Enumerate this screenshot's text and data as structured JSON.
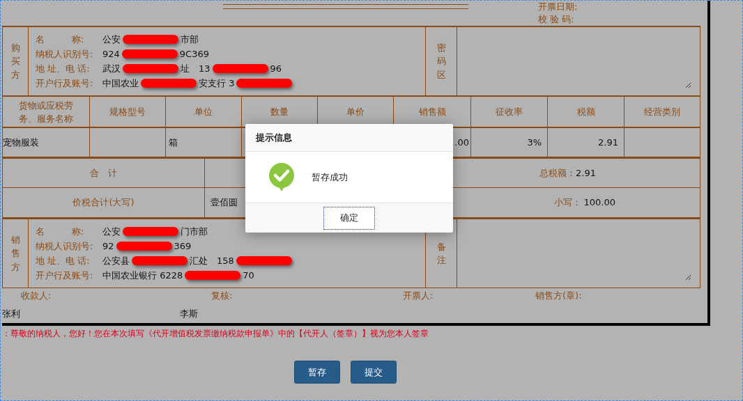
{
  "header": {
    "date_label": "开票日期:",
    "check_code_label": "校 验 码:"
  },
  "buyer": {
    "side_label": "购买方",
    "box_label": "密码区",
    "fields": [
      {
        "label": "名　　　称:",
        "value": [
          {
            "kind": "text",
            "text": "公安"
          },
          {
            "kind": "redaction"
          },
          {
            "kind": "text",
            "text": "市部"
          }
        ]
      },
      {
        "label": "纳税人识别号:",
        "value": [
          {
            "kind": "text",
            "text": "924"
          },
          {
            "kind": "redaction"
          },
          {
            "kind": "text",
            "text": "9C369"
          }
        ]
      },
      {
        "label": "地 址、电 话:",
        "value": [
          {
            "kind": "text",
            "text": "武汉"
          },
          {
            "kind": "redaction"
          },
          {
            "kind": "text",
            "text": "址　13"
          },
          {
            "kind": "redaction"
          },
          {
            "kind": "text",
            "text": "96"
          }
        ]
      },
      {
        "label": "开户行及账号:",
        "value": [
          {
            "kind": "text",
            "text": "中国农业"
          },
          {
            "kind": "redaction"
          },
          {
            "kind": "text",
            "text": "安支行 3"
          },
          {
            "kind": "redaction"
          }
        ]
      }
    ]
  },
  "goods": {
    "columns": [
      "货物或应税劳务、服务名称",
      "规格型号",
      "单位",
      "数量",
      "单价",
      "销售额",
      "征收率",
      "税额",
      "经营类别"
    ],
    "rows": [
      {
        "name": "宠物服装",
        "unit": "箱",
        "amount": ".00",
        "rate": "3%",
        "tax": "2.91"
      }
    ]
  },
  "totals": {
    "total_label": "合　计",
    "tax_total_label": "总税额：",
    "tax_total": "2.91",
    "grand_label": "价税合计(大写)",
    "grand_words": "壹佰圆",
    "small_label": "小写：",
    "small_value": "100.00"
  },
  "seller": {
    "side_label": "销售方",
    "box_label": "备注",
    "fields": [
      {
        "label": "名　　　称:",
        "value": [
          {
            "kind": "text",
            "text": "公安"
          },
          {
            "kind": "redaction"
          },
          {
            "kind": "text",
            "text": "门市部"
          }
        ]
      },
      {
        "label": "纳税人识别号:",
        "value": [
          {
            "kind": "text",
            "text": "92"
          },
          {
            "kind": "redaction"
          },
          {
            "kind": "text",
            "text": "369"
          }
        ]
      },
      {
        "label": "地 址、电 话:",
        "value": [
          {
            "kind": "text",
            "text": "公安县"
          },
          {
            "kind": "redaction"
          },
          {
            "kind": "text",
            "text": "汇处　158"
          },
          {
            "kind": "redaction"
          }
        ]
      },
      {
        "label": "开户行及账号:",
        "value": [
          {
            "kind": "text",
            "text": "中国农业银行 6228"
          },
          {
            "kind": "redaction"
          },
          {
            "kind": "text",
            "text": "70"
          }
        ]
      }
    ]
  },
  "signatures": [
    {
      "label": "收款人:",
      "value": "张利"
    },
    {
      "label": "复核:",
      "value": "李斯"
    },
    {
      "label": "开票人:"
    },
    {
      "label": "销售方(章):"
    }
  ],
  "notice": "：尊敬的纳税人，您好！您在本次填写《代开增值税发票缴纳税款申报单》中的【代开人（签章）】视为您本人签章",
  "buttons": [
    "暂存",
    "提交"
  ],
  "dialog": {
    "title": "提示信息",
    "message": "暂存成功",
    "button": "确定"
  }
}
